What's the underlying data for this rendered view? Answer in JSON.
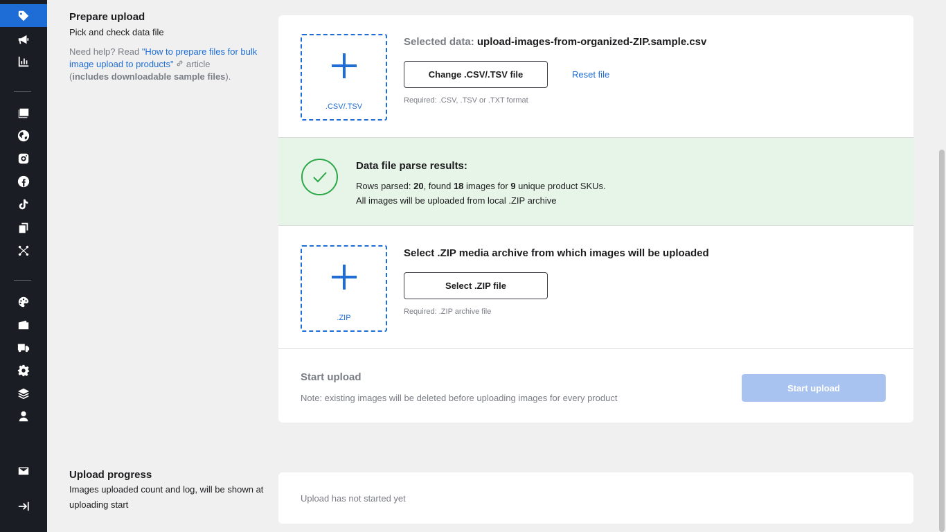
{
  "sidebar": {
    "items": [
      {
        "icon": "tag-icon",
        "active": true
      },
      {
        "icon": "megaphone-icon"
      },
      {
        "icon": "chart-icon"
      },
      {
        "icon": "catalog-icon"
      },
      {
        "icon": "globe-icon"
      },
      {
        "icon": "instagram-icon"
      },
      {
        "icon": "facebook-icon"
      },
      {
        "icon": "tiktok-icon"
      },
      {
        "icon": "devices-icon"
      },
      {
        "icon": "integrations-icon"
      },
      {
        "icon": "palette-icon"
      },
      {
        "icon": "wallet-icon"
      },
      {
        "icon": "truck-icon"
      },
      {
        "icon": "gear-icon"
      },
      {
        "icon": "layers-icon"
      },
      {
        "icon": "user-icon"
      },
      {
        "icon": "mail-icon"
      },
      {
        "icon": "collapse-icon"
      }
    ]
  },
  "prepare": {
    "title": "Prepare upload",
    "subtitle": "Pick and check data file",
    "help_prefix": "Need help? Read ",
    "help_link": "\"How to prepare files for bulk image upload to products\"",
    "help_after": " article",
    "help_bold": "includes downloadable sample files",
    "help_paren_open": "(",
    "help_paren_close": ")."
  },
  "data_file": {
    "dropzone_label": ".CSV/.TSV",
    "selected_label": "Selected data:",
    "selected_file": "upload-images-from-organized-ZIP.sample.csv",
    "change_button": "Change .CSV/.TSV file",
    "reset_link": "Reset file",
    "required": "Required: .CSV, .TSV or .TXT format"
  },
  "parse": {
    "title": "Data file parse results:",
    "rows_label": "Rows parsed: ",
    "rows_value": "20",
    "found_label": ", found ",
    "images_value": "18",
    "images_label": " images for ",
    "skus_value": "9",
    "skus_label": " unique product SKUs.",
    "line2": "All images will be uploaded from local .ZIP archive"
  },
  "zip": {
    "dropzone_label": ".ZIP",
    "title": "Select .ZIP media archive from which images will be uploaded",
    "select_button": "Select .ZIP file",
    "required": "Required: .ZIP archive file"
  },
  "start": {
    "title": "Start upload",
    "note": "Note: existing images will be deleted before uploading images for every product",
    "button": "Start upload"
  },
  "progress": {
    "title": "Upload progress",
    "subtitle": "Images uploaded count and log, will be shown at uploading start",
    "status": "Upload has not started yet"
  },
  "colors": {
    "accent": "#1e6dd6",
    "success": "#2ba748",
    "success_bg": "#e7f5e9",
    "sidebar_bg": "#1b1d24"
  }
}
